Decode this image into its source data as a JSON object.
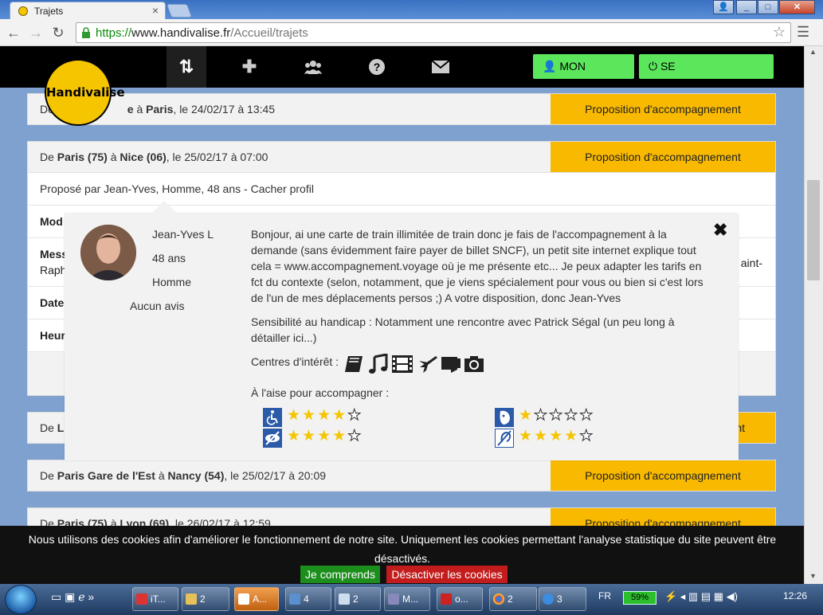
{
  "browser": {
    "tab_title": "Trajets",
    "tab_close": "×",
    "url_scheme": "https://",
    "url_host": "www.handivalise.fr",
    "url_path": "/Accueil/trajets",
    "window_buttons": {
      "user": "👤",
      "minimize": "_",
      "maximize": "□",
      "close": "✕"
    }
  },
  "site": {
    "logo_text": "Handivalise",
    "nav_icons": [
      "sort-arrows-icon",
      "plus-icon",
      "group-icon",
      "help-icon",
      "mail-icon"
    ],
    "profile_label": "MON PROFIL",
    "logout_label": "SE DECONNECTER"
  },
  "trips": [
    {
      "prefix": "De ",
      "from": "",
      "to_word": "",
      "to_bold_mid": "e",
      "middle": " à ",
      "dest": "Paris",
      "date": ", le 24/02/17 à 13:45",
      "action": "Proposition d'accompagnement"
    },
    {
      "prefix": "De ",
      "from": "Paris (75)",
      "middle": " à ",
      "dest": "Nice (06)",
      "date": ", le 25/02/17 à 07:00",
      "action": "Proposition d'accompagnement"
    },
    {
      "prefix": "De ",
      "from": "Lo",
      "action": "nt"
    },
    {
      "prefix": "De ",
      "from": "Paris Gare de l'Est",
      "middle": " à ",
      "dest": "Nancy (54)",
      "date": ", le 25/02/17 à 20:09",
      "action": "Proposition d'accompagnement"
    },
    {
      "prefix": "De ",
      "from": "Paris (75)",
      "middle": " à ",
      "dest": "Lyon (69)",
      "date": ", le 26/02/17 à 12:59",
      "action": "Proposition d'accompagnement"
    }
  ],
  "expanded": {
    "proposed_by": "Proposé par Jean-Yves, Homme, 48 ans - ",
    "hide_profile": "Cacher profil",
    "rows": [
      "Mod",
      "Mess",
      "Date",
      "Heur"
    ],
    "row_fragment_raph": "Raph",
    "right_fragment": "aint-"
  },
  "profile": {
    "name": "Jean-Yves L",
    "age": "48 ans",
    "gender": "Homme",
    "reviews": "Aucun avis",
    "bio": "Bonjour, ai une carte de train illimitée de train donc je fais de l'accompagnement à la demande (sans évidemment faire payer de billet SNCF), un petit site internet explique tout cela = www.accompagnement.voyage où je me présente etc... Je peux adapter les tarifs en fct du contexte (selon, notamment, que je viens spécialement pour vous ou bien si c'est lors de l'un de mes déplacements persos ;) A votre disposition, donc Jean-Yves",
    "sensibility": "Sensibilité au handicap : Notamment une rencontre avec Patrick Ségal (un peu long à détailler ici...)",
    "interests_label": "Centres d'intérêt :",
    "interests": [
      "book-icon",
      "music-icon",
      "film-icon",
      "plane-icon",
      "comedy-icon",
      "camera-icon"
    ],
    "comfort_label": "À l'aise pour accompagner :",
    "ratings": [
      {
        "handicap": "wheelchair-icon",
        "stars": 4
      },
      {
        "handicap": "visual-impairment-icon",
        "stars": 4
      },
      {
        "handicap": "mental-disability-icon",
        "stars": 1
      },
      {
        "handicap": "hearing-impairment-icon",
        "stars": 4
      }
    ]
  },
  "cookie": {
    "text": "Nous utilisons des cookies afin d'améliorer le fonctionnement de notre site. Uniquement les cookies permettant l'analyse statistique du site peuvent être désactivés.",
    "accept": "Je comprends",
    "reject": "Désactiver les cookies"
  },
  "taskbar": {
    "items": [
      "iT...",
      "2",
      "A...",
      "4",
      "2",
      "M...",
      "o...",
      "2",
      "3"
    ],
    "lang": "FR",
    "battery": "59%",
    "time": "12:26"
  },
  "colors": {
    "accent_yellow": "#f8b900",
    "green": "#5ce65c",
    "nav_bg": "#000000",
    "page_bg": "#7ea1d0"
  }
}
